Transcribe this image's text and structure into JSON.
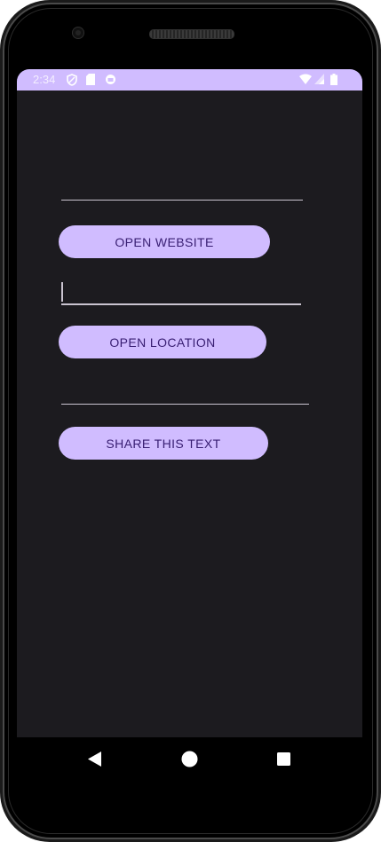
{
  "status_bar": {
    "time": "2:34",
    "icons": [
      "shield-icon",
      "sim-card-icon",
      "sync-icon",
      "wifi-icon",
      "signal-icon",
      "battery-icon"
    ],
    "background": "#d0bcff"
  },
  "main": {
    "url_field": {
      "value": "",
      "placeholder": ""
    },
    "open_website_label": "OPEN WEBSITE",
    "location_field": {
      "value": "",
      "placeholder": ""
    },
    "open_location_label": "OPEN LOCATION",
    "share_field": {
      "value": "",
      "placeholder": ""
    },
    "share_text_label": "SHARE THIS TEXT"
  },
  "nav_bar": {
    "icons": [
      "back-icon",
      "home-icon",
      "recents-icon"
    ]
  },
  "colors": {
    "accent": "#d0bcff",
    "on_accent": "#381e72",
    "background": "#1c1b1f",
    "outline": "#cac4d0"
  }
}
